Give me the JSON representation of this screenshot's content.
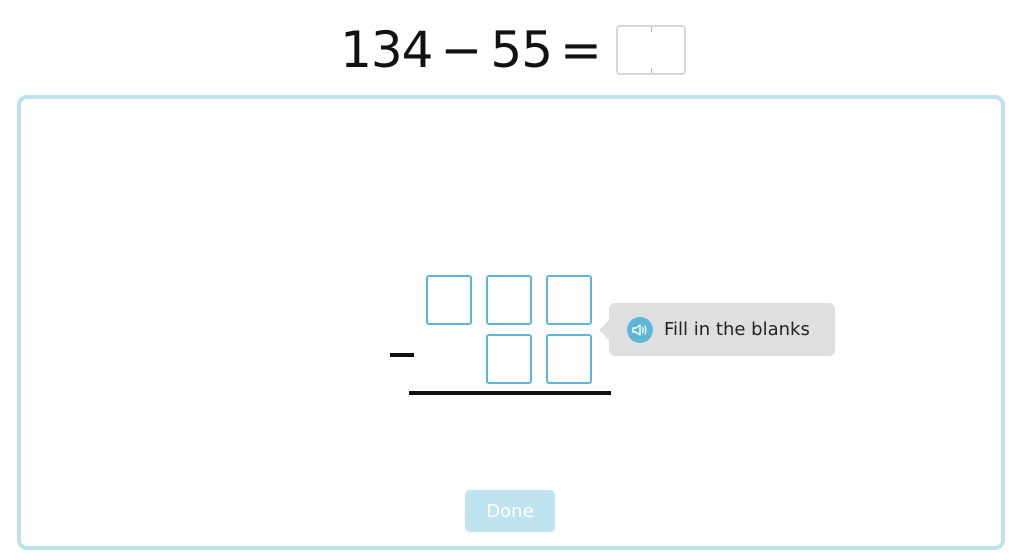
{
  "equation": {
    "minuend": "134",
    "operator": "−",
    "subtrahend": "55",
    "equals": "=",
    "answer_value": ""
  },
  "work_area": {
    "operator": "−",
    "top_row_boxes": [
      "",
      "",
      ""
    ],
    "bottom_row_boxes": [
      "",
      ""
    ]
  },
  "tooltip": {
    "icon": "speaker-icon",
    "text": "Fill in the blanks"
  },
  "done_button": {
    "label": "Done"
  },
  "colors": {
    "work_area_border": "#bde2ee",
    "input_border": "#5fb5d6",
    "tooltip_bg": "#dfdfdf",
    "speaker_icon_bg": "#5fb5d6",
    "done_button_bg": "#bfe4f0"
  }
}
